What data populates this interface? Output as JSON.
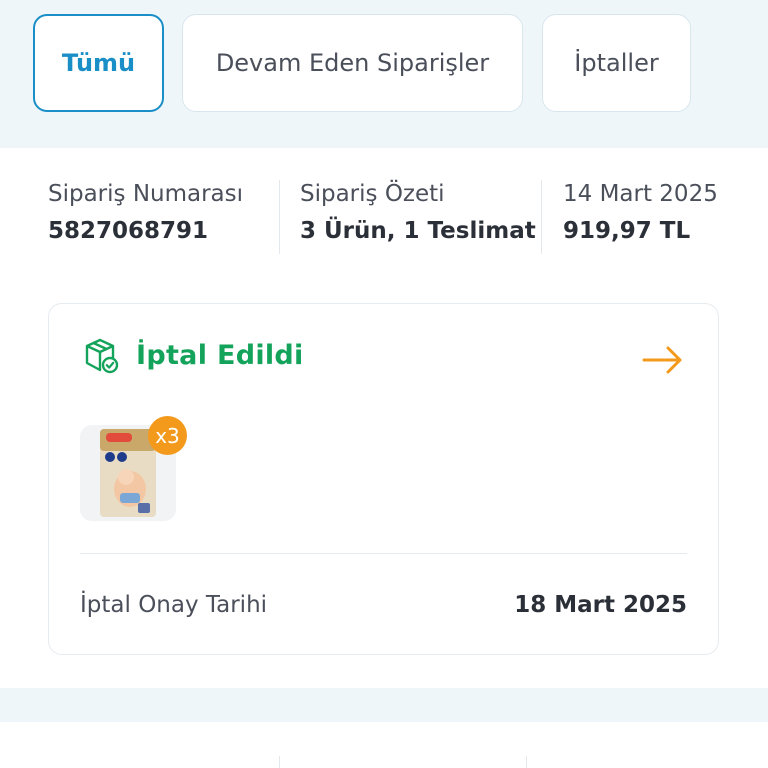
{
  "tabs": [
    {
      "label": "Tümü",
      "active": true
    },
    {
      "label": "Devam Eden Siparişler",
      "active": false
    },
    {
      "label": "İptaller",
      "active": false
    }
  ],
  "order": {
    "number_label": "Sipariş Numarası",
    "number_value": "5827068791",
    "summary_label": "Sipariş Özeti",
    "summary_value": "3 Ürün, 1 Teslimat",
    "date": "14 Mart 2025",
    "total": "919,97 TL"
  },
  "status_card": {
    "status": "İptal Edildi",
    "status_icon": "box-check-icon",
    "arrow_icon": "arrow-right-icon",
    "quantity_badge": "x3",
    "date_label": "İptal Onay Tarihi",
    "date_value": "18 Mart 2025"
  },
  "colors": {
    "accent_blue": "#1a8fc7",
    "status_green": "#14a35a",
    "arrow_orange": "#f39a1d",
    "badge_orange": "#f39a1d",
    "band_bg": "#eef6fa"
  }
}
